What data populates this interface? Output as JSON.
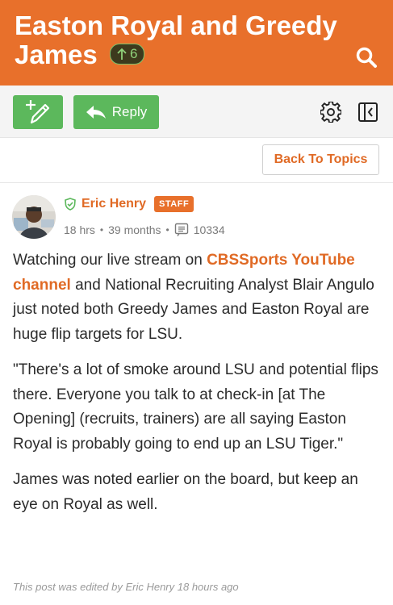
{
  "header": {
    "title_line1": "Easton Royal and Greedy",
    "title_line2": "James",
    "upvote_count": "6",
    "bg_color": "#e8702b"
  },
  "toolbar": {
    "reply_label": "Reply",
    "back_label": "Back To Topics"
  },
  "post": {
    "author": "Eric Henry",
    "badge": "STAFF",
    "time": "18 hrs",
    "tenure": "39 months",
    "post_count": "10334",
    "p1_before": "Watching our live stream on ",
    "p1_link": "CBSSports YouTube channel",
    "p1_after": " and National Recruiting Analyst Blair Angulo just noted both Greedy James and Easton Royal are huge flip targets for LSU.",
    "p2": "\"There's a lot of smoke around LSU and potential flips there. Everyone you talk to at check-in [at The Opening] (recruits, trainers) are all saying Easton Royal is probably going to end up an LSU Tiger.\"",
    "p3": "James was noted earlier on the board, but keep an eye on Royal as well.",
    "edited_note": "This post was edited by Eric Henry 18 hours ago"
  }
}
